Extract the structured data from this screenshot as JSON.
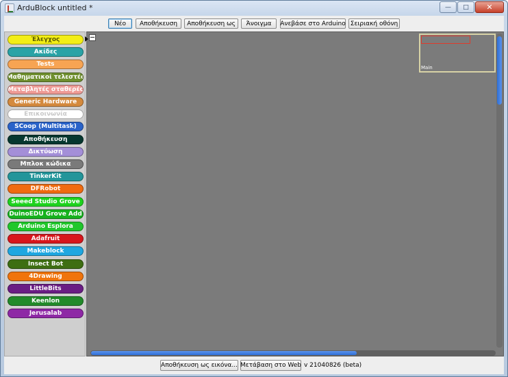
{
  "window": {
    "title": "ArduBlock untitled *",
    "controls": {
      "minimize": "—",
      "maximize": "□",
      "close": "✕"
    }
  },
  "toolbar": {
    "buttons": [
      {
        "label": "Νέο"
      },
      {
        "label": "Αποθήκευση"
      },
      {
        "label": "Αποθήκευση ως"
      },
      {
        "label": "Άνοιγμα"
      },
      {
        "label": "Ανεβάσε στο Arduino"
      },
      {
        "label": "Σειριακή οθόνη"
      }
    ]
  },
  "palette": {
    "categories": [
      {
        "label": "Έλεγχος",
        "color": "#f3ee16",
        "text_color": "#5c5a00"
      },
      {
        "label": "Ακίδες",
        "color": "#2aa3a6",
        "text_color": "#ffffff"
      },
      {
        "label": "Tests",
        "color": "#f7a453",
        "text_color": "#ffffff"
      },
      {
        "label": "Μαθηματικοί τελεστές",
        "color": "#6f8f2e",
        "text_color": "#ffffff"
      },
      {
        "label": "Μεταβλητές σταθερές",
        "color": "#ee9a95",
        "text_color": "#ffffff"
      },
      {
        "label": "Generic Hardware",
        "color": "#d48a3e",
        "text_color": "#ffffff"
      },
      {
        "label": "Επικοινωνία",
        "color": "#ffffff",
        "text_color": "#c9c9c9"
      },
      {
        "label": "SCoop (Multitask)",
        "color": "#2a63c9",
        "text_color": "#ffffff"
      },
      {
        "label": "Αποθήκευση",
        "color": "#06372f",
        "text_color": "#ffffff"
      },
      {
        "label": "Δικτύωση",
        "color": "#a48fd8",
        "text_color": "#ffffff"
      },
      {
        "label": "Μπλοκ κώδικα",
        "color": "#7a7a7a",
        "text_color": "#ffffff"
      },
      {
        "label": "TinkerKit",
        "color": "#23959a",
        "text_color": "#ffffff"
      },
      {
        "label": "DFRobot",
        "color": "#f06b10",
        "text_color": "#ffffff"
      },
      {
        "label": "Seeed Studio Grove",
        "color": "#1ed31e",
        "text_color": "#ffffff"
      },
      {
        "label": "DuinoEDU Grove Add",
        "color": "#16b21d",
        "text_color": "#ffffff"
      },
      {
        "label": "Arduino Esplora",
        "color": "#20c72b",
        "text_color": "#ffffff"
      },
      {
        "label": "Adafruit",
        "color": "#d7161c",
        "text_color": "#ffffff"
      },
      {
        "label": "Makeblock",
        "color": "#1fa7e0",
        "text_color": "#ffffff"
      },
      {
        "label": "Insect Bot",
        "color": "#3e6e12",
        "text_color": "#ffffff"
      },
      {
        "label": "4Drawing",
        "color": "#f0740c",
        "text_color": "#ffffff"
      },
      {
        "label": "LittleBits",
        "color": "#6a1d84",
        "text_color": "#ffffff"
      },
      {
        "label": "Keenlon",
        "color": "#228a2a",
        "text_color": "#ffffff"
      },
      {
        "label": "Jerusalab",
        "color": "#8e28a5",
        "text_color": "#ffffff"
      }
    ]
  },
  "workspace": {
    "minimap_label": "Main",
    "background_color": "#7b7b7b",
    "vertical_scroll_position": 0.0,
    "horizontal_scroll_position": 0.0
  },
  "bottombar": {
    "save_image_label": "Αποθήκευση ως εικόνα...",
    "web_label": "Μετάβαση στο Web",
    "version": "v 21040826 (beta)"
  }
}
